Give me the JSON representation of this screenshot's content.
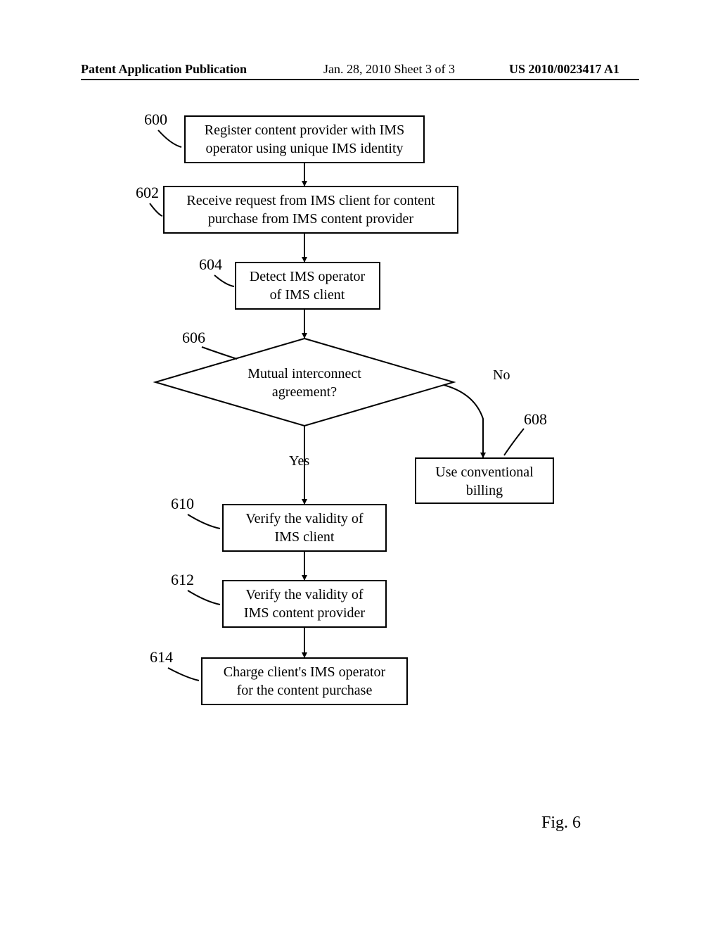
{
  "header": {
    "left": "Patent Application Publication",
    "center": "Jan. 28, 2010  Sheet 3 of 3",
    "right": "US 2010/0023417 A1"
  },
  "figure_label": "Fig. 6",
  "nodes": {
    "n600": {
      "ref": "600",
      "line1": "Register content provider with IMS",
      "line2": "operator using unique IMS identity"
    },
    "n602": {
      "ref": "602",
      "line1": "Receive request from IMS client for content",
      "line2": "purchase from IMS content provider"
    },
    "n604": {
      "ref": "604",
      "line1": "Detect IMS operator",
      "line2": "of IMS client"
    },
    "n606": {
      "ref": "606",
      "line1": "Mutual interconnect",
      "line2": "agreement?"
    },
    "n608": {
      "ref": "608",
      "line1": "Use conventional",
      "line2": "billing"
    },
    "n610": {
      "ref": "610",
      "line1": "Verify the validity of",
      "line2": "IMS client"
    },
    "n612": {
      "ref": "612",
      "line1": "Verify the validity of",
      "line2": "IMS content provider"
    },
    "n614": {
      "ref": "614",
      "line1": "Charge client's IMS operator",
      "line2": "for the content purchase"
    }
  },
  "edges": {
    "yes": "Yes",
    "no": "No"
  }
}
